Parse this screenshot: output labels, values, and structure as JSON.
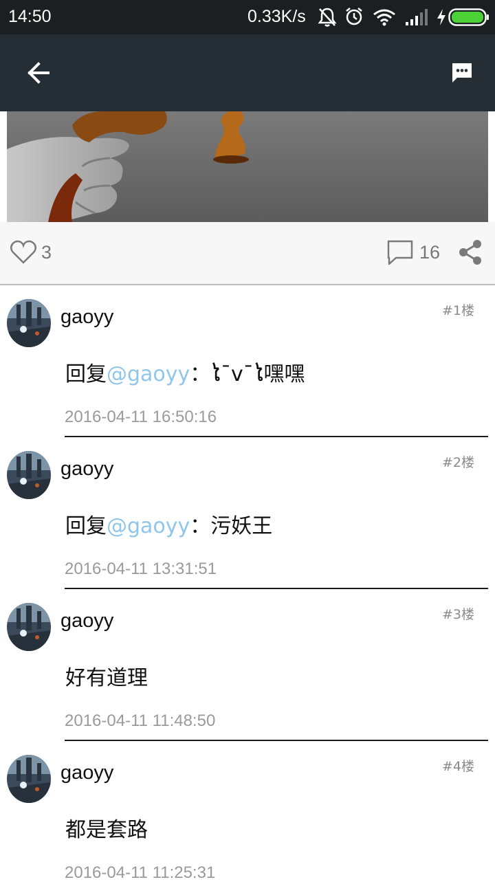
{
  "status_bar": {
    "time": "14:50",
    "net_speed": "0.33K/s",
    "icons": [
      "bell-muted-icon",
      "alarm-icon",
      "wifi-icon",
      "signal-icon",
      "charging-icon",
      "battery-icon"
    ]
  },
  "app_bar": {
    "back_icon": "arrow-left-icon",
    "message_icon": "message-icon"
  },
  "actions": {
    "like_count": "3",
    "comment_count": "16",
    "like_icon": "heart-icon",
    "comment_icon": "comment-icon",
    "share_icon": "share-icon"
  },
  "comments": [
    {
      "username": "gaoyy",
      "floor": "#1楼",
      "prefix": "回复",
      "mention": "@gaoyy",
      "body": "：ໄ¯v¯ໄ嘿嘿",
      "time": "2016-04-11 16:50:16"
    },
    {
      "username": "gaoyy",
      "floor": "#2楼",
      "prefix": "回复",
      "mention": "@gaoyy",
      "body": "：污妖王",
      "time": "2016-04-11 13:31:51"
    },
    {
      "username": "gaoyy",
      "floor": "#3楼",
      "prefix": "",
      "mention": "",
      "body": "好有道理",
      "time": "2016-04-11 11:48:50"
    },
    {
      "username": "gaoyy",
      "floor": "#4楼",
      "prefix": "",
      "mention": "",
      "body": "都是套路",
      "time": "2016-04-11 11:25:31"
    }
  ],
  "colors": {
    "status_bar_bg": "#1b1f22",
    "app_bar_bg": "#262e35",
    "mention": "#8fc6ea",
    "battery": "#4cd137"
  }
}
